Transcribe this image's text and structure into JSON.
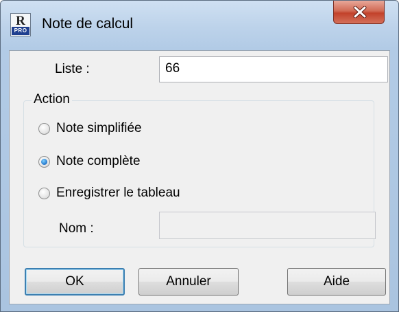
{
  "window": {
    "title": "Note de calcul",
    "icon": {
      "name": "robot-pro-app-icon",
      "letter": "R",
      "badge": "PRO"
    },
    "close_icon": "close-x-icon"
  },
  "form": {
    "liste_label": "Liste :",
    "liste_value": "66",
    "action_group_label": "Action",
    "options": [
      {
        "label": "Note simplifiée",
        "selected": false
      },
      {
        "label": "Note complète",
        "selected": true
      },
      {
        "label": "Enregistrer le tableau",
        "selected": false
      }
    ],
    "nom_label": "Nom :",
    "nom_value": ""
  },
  "buttons": {
    "ok": "OK",
    "annuler": "Annuler",
    "aide": "Aide"
  },
  "colors": {
    "frame": "#b2cbe6",
    "close_button": "#c2422b",
    "default_button_border": "#3c7fb1",
    "radio_selected": "#1f73c9"
  }
}
